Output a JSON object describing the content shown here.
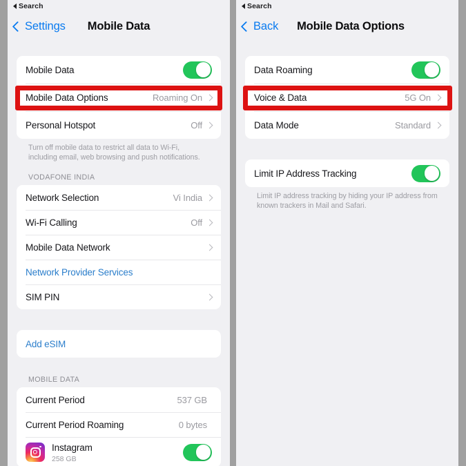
{
  "meta": {
    "platform": "iOS Settings",
    "accent_blue": "#0a7bf0",
    "toggle_green": "#22c55a",
    "highlight_red": "#dd1212",
    "background_gray": "#a0a0a0",
    "panel_bg": "#f0f0f3"
  },
  "left_panel": {
    "statusbar": {
      "back_label": "Search",
      "back_icon": "triangle-left-icon"
    },
    "nav": {
      "back_label": "Settings",
      "back_icon": "chevron-left-icon",
      "title": "Mobile Data"
    },
    "group1": {
      "rows": [
        {
          "label": "Mobile Data",
          "control": "toggle",
          "toggle_on": true
        },
        {
          "label": "Mobile Data Options",
          "value": "Roaming On",
          "control": "chevron",
          "highlighted": true
        },
        {
          "label": "Personal Hotspot",
          "value": "Off",
          "control": "chevron"
        }
      ],
      "footnote": "Turn off mobile data to restrict all data to Wi-Fi, including email, web browsing and push notifications."
    },
    "group2": {
      "header": "VODAFONE INDIA",
      "rows": [
        {
          "label": "Network Selection",
          "value": "Vi India",
          "control": "chevron"
        },
        {
          "label": "Wi-Fi Calling",
          "value": "Off",
          "control": "chevron"
        },
        {
          "label": "Mobile Data Network",
          "value": "",
          "control": "chevron"
        },
        {
          "label": "Network Provider Services",
          "value": "",
          "control": "none",
          "link": true
        },
        {
          "label": "SIM PIN",
          "value": "",
          "control": "chevron"
        }
      ]
    },
    "group3": {
      "rows": [
        {
          "label": "Add eSIM",
          "value": "",
          "control": "none",
          "link": true
        }
      ]
    },
    "group4": {
      "header": "MOBILE DATA",
      "rows": [
        {
          "label": "Current Period",
          "value": "537 GB",
          "control": "none"
        },
        {
          "label": "Current Period Roaming",
          "value": "0 bytes",
          "control": "none"
        }
      ],
      "app": {
        "icon": "instagram-icon",
        "name": "Instagram",
        "size": "258 GB",
        "toggle_on": true
      }
    }
  },
  "right_panel": {
    "statusbar": {
      "back_label": "Search",
      "back_icon": "triangle-left-icon"
    },
    "nav": {
      "back_label": "Back",
      "back_icon": "chevron-left-icon",
      "title": "Mobile Data Options"
    },
    "group1": {
      "rows": [
        {
          "label": "Data Roaming",
          "control": "toggle",
          "toggle_on": true
        },
        {
          "label": "Voice & Data",
          "value": "5G On",
          "control": "chevron",
          "highlighted": true
        },
        {
          "label": "Data Mode",
          "value": "Standard",
          "control": "chevron"
        }
      ]
    },
    "group2": {
      "rows": [
        {
          "label": "Limit IP Address Tracking",
          "control": "toggle",
          "toggle_on": true
        }
      ],
      "footnote": "Limit IP address tracking by hiding your IP address from known trackers in Mail and Safari."
    }
  }
}
